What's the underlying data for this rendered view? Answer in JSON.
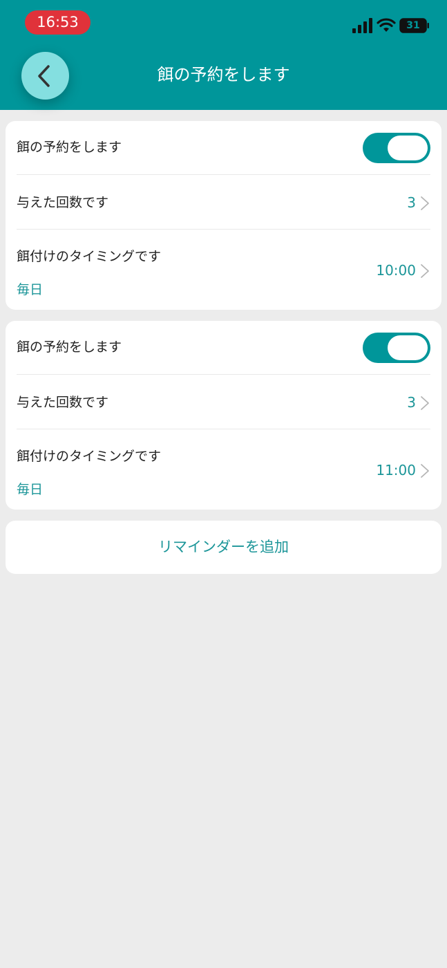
{
  "status_bar": {
    "time": "16:53",
    "battery": "31",
    "signal_icon": "signal-bars-icon",
    "wifi_icon": "wifi-icon",
    "battery_icon": "battery-icon"
  },
  "header": {
    "title": "餌の予約をします",
    "back_icon": "chevron-left-icon"
  },
  "schedules": [
    {
      "toggle_label": "餌の予約をします",
      "enabled": true,
      "count_label": "与えた回数です",
      "count_value": "3",
      "timing_label": "餌付けのタイミングです",
      "timing_value": "10:00",
      "repeat": "毎日"
    },
    {
      "toggle_label": "餌の予約をします",
      "enabled": true,
      "count_label": "与えた回数です",
      "count_value": "3",
      "timing_label": "餌付けのタイミングです",
      "timing_value": "11:00",
      "repeat": "毎日"
    }
  ],
  "add_reminder_label": "リマインダーを追加",
  "colors": {
    "header": "#00969a",
    "accent": "#1b9598",
    "back_button": "#84dfe0",
    "status_time_bg": "#e0323a",
    "page_bg": "#ececec"
  }
}
